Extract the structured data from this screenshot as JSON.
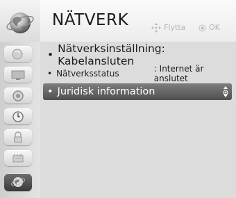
{
  "header": {
    "title": "NÄTVERK",
    "hint_move": "Flytta",
    "hint_ok": "OK"
  },
  "sidebar": {
    "items": [
      {
        "icon": "picture-icon"
      },
      {
        "icon": "screen-icon"
      },
      {
        "icon": "audio-icon"
      },
      {
        "icon": "clock-icon"
      },
      {
        "icon": "lock-icon"
      },
      {
        "icon": "options-icon"
      },
      {
        "icon": "network-globe-icon",
        "active": true
      }
    ]
  },
  "menu": {
    "items": [
      {
        "label": "Nätverksinställning: Kabelansluten"
      },
      {
        "label": "Nätverksstatus",
        "value": ": Internet är anslutet"
      },
      {
        "label": "Juridisk information",
        "selected": true
      }
    ]
  }
}
